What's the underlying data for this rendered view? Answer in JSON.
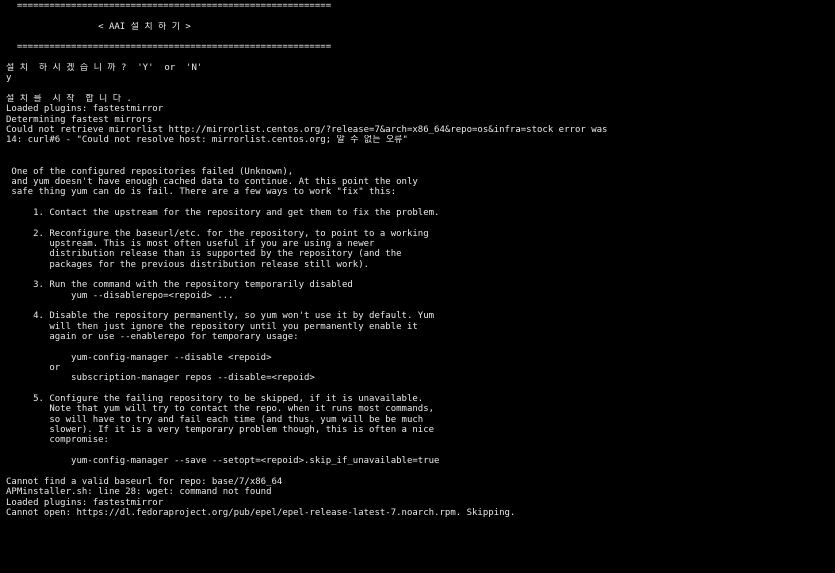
{
  "terminal": {
    "lines": [
      "  ==========================================================",
      "",
      "                 < AAI 설 치 하 기 >",
      "",
      "  ==========================================================",
      "",
      "설 치  하 시 겠 습 니 까 ?  'Y'  or  'N'",
      "y",
      "",
      "설 치 를  시 작  합 니 다 .",
      "Loaded plugins: fastestmirror",
      "Determining fastest mirrors",
      "Could not retrieve mirrorlist http://mirrorlist.centos.org/?release=7&arch=x86_64&repo=os&infra=stock error was",
      "14: curl#6 - \"Could not resolve host: mirrorlist.centos.org; 알 수 없는 오류\"",
      "",
      "",
      " One of the configured repositories failed (Unknown),",
      " and yum doesn't have enough cached data to continue. At this point the only",
      " safe thing yum can do is fail. There are a few ways to work \"fix\" this:",
      "",
      "     1. Contact the upstream for the repository and get them to fix the problem.",
      "",
      "     2. Reconfigure the baseurl/etc. for the repository, to point to a working",
      "        upstream. This is most often useful if you are using a newer",
      "        distribution release than is supported by the repository (and the",
      "        packages for the previous distribution release still work).",
      "",
      "     3. Run the command with the repository temporarily disabled",
      "            yum --disablerepo=<repoid> ...",
      "",
      "     4. Disable the repository permanently, so yum won't use it by default. Yum",
      "        will then just ignore the repository until you permanently enable it",
      "        again or use --enablerepo for temporary usage:",
      "",
      "            yum-config-manager --disable <repoid>",
      "        or",
      "            subscription-manager repos --disable=<repoid>",
      "",
      "     5. Configure the failing repository to be skipped, if it is unavailable.",
      "        Note that yum will try to contact the repo. when it runs most commands,",
      "        so will have to try and fail each time (and thus. yum will be be much",
      "        slower). If it is a very temporary problem though, this is often a nice",
      "        compromise:",
      "",
      "            yum-config-manager --save --setopt=<repoid>.skip_if_unavailable=true",
      "",
      "Cannot find a valid baseurl for repo: base/7/x86_64",
      "APMinstaller.sh: line 28: wget: command not found",
      "Loaded plugins: fastestmirror",
      "Cannot open: https://dl.fedoraproject.org/pub/epel/epel-release-latest-7.noarch.rpm. Skipping."
    ]
  },
  "colors": {
    "background": "#000000",
    "foreground": "#e8e8e8"
  }
}
